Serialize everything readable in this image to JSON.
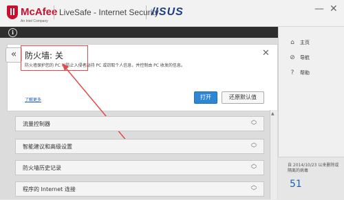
{
  "header": {
    "brand": "McAfee",
    "brand_sub": "An Intel Company",
    "product": "LiveSafe - Internet Security",
    "partner": "/ISUS",
    "minimize": "—",
    "close": "✕"
  },
  "panel": {
    "back": "«",
    "title": "防火墙: 关",
    "description": "防火墙保护您的 PC 以防止入侵者劫持 PC 或窃取个人信息，并控制由 PC 收发的信息。",
    "close": "✕",
    "learn_more": "了解更多",
    "primary_button": "打开",
    "secondary_button": "还原默认值"
  },
  "rows": [
    {
      "label": "流量控制器"
    },
    {
      "label": "智能建议和高级设置"
    },
    {
      "label": "防火墙历史记录"
    },
    {
      "label": "程序的 Internet 连接"
    }
  ],
  "sidebar": {
    "items": [
      {
        "label": "主页",
        "icon": "home-icon"
      },
      {
        "label": "导航",
        "icon": "compass-icon"
      },
      {
        "label": "帮助",
        "icon": "help-icon"
      }
    ],
    "note": "自 2014/10/23 以来删除或隔离的病毒",
    "count": "51"
  },
  "colors": {
    "accent": "#2f86d3",
    "brand": "#c8102e",
    "annotation": "#e04a4a"
  }
}
